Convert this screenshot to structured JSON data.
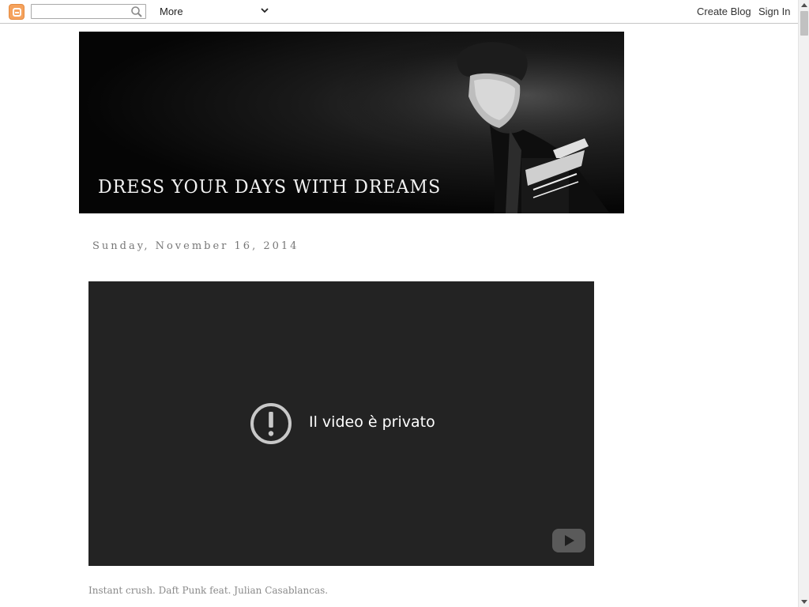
{
  "navbar": {
    "search": {
      "value": "",
      "placeholder": ""
    },
    "more_label": "More",
    "create_blog": "Create Blog",
    "sign_in": "Sign In"
  },
  "header": {
    "title": "DRESS YOUR DAYS WITH DREAMS"
  },
  "post": {
    "date": "Sunday, November 16, 2014",
    "video_message": "Il video è privato",
    "caption": "Instant crush. Daft Punk feat. Julian Casablancas."
  },
  "colors": {
    "blogger_orange": "#f5a25d",
    "video_bg": "#232323",
    "caption_text": "#8a8a8a"
  },
  "icons": {
    "logo": "blogger-logo-icon",
    "search": "search-icon",
    "dropdown": "chevron-down-icon",
    "warning": "warning-circle-icon",
    "youtube": "youtube-logo-icon"
  }
}
